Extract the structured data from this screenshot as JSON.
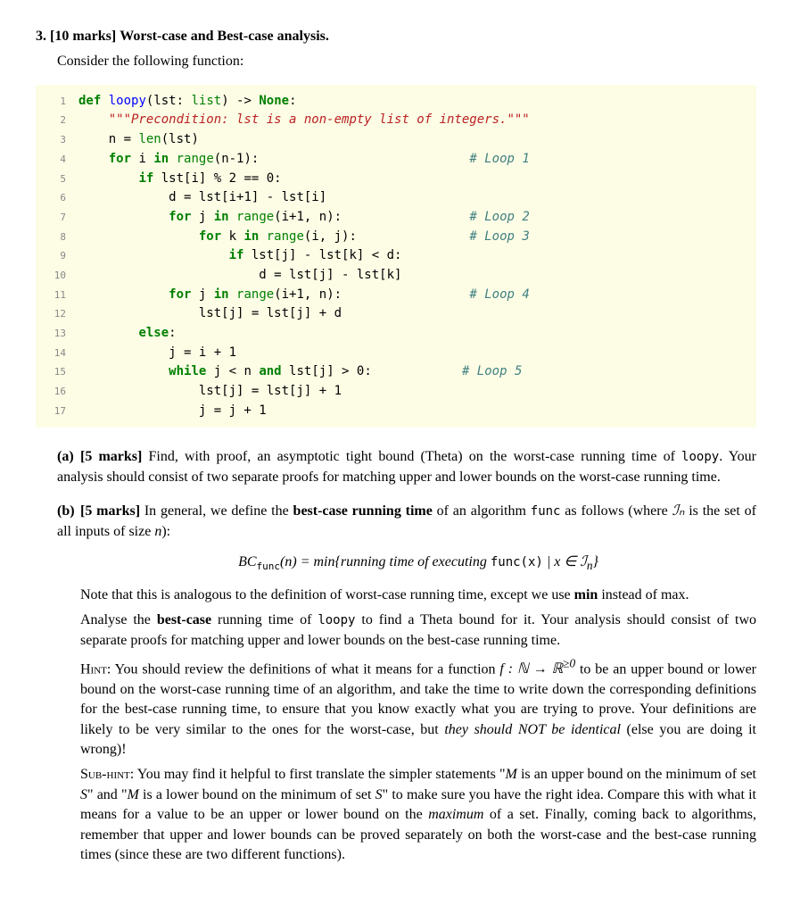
{
  "question": {
    "number": "3.",
    "marks": "[10 marks]",
    "title": "Worst-case and Best-case analysis.",
    "intro": "Consider the following function:"
  },
  "code": {
    "lines": [
      {
        "n": "1",
        "indent": 0,
        "tokens": [
          {
            "t": "kw",
            "v": "def"
          },
          {
            "t": "sp",
            "v": " "
          },
          {
            "t": "fn",
            "v": "loopy"
          },
          {
            "t": "ident",
            "v": "(lst: "
          },
          {
            "t": "bi",
            "v": "list"
          },
          {
            "t": "ident",
            "v": ") -> "
          },
          {
            "t": "kw",
            "v": "None"
          },
          {
            "t": "ident",
            "v": ":"
          }
        ]
      },
      {
        "n": "2",
        "indent": 1,
        "tokens": [
          {
            "t": "str",
            "v": "\"\"\"Precondition: lst is a non-empty list of integers.\"\"\""
          }
        ]
      },
      {
        "n": "3",
        "indent": 1,
        "tokens": [
          {
            "t": "ident",
            "v": "n = "
          },
          {
            "t": "bi",
            "v": "len"
          },
          {
            "t": "ident",
            "v": "(lst)"
          }
        ]
      },
      {
        "n": "4",
        "indent": 1,
        "tokens": [
          {
            "t": "kw",
            "v": "for"
          },
          {
            "t": "ident",
            "v": " i "
          },
          {
            "t": "kw",
            "v": "in"
          },
          {
            "t": "ident",
            "v": " "
          },
          {
            "t": "bi",
            "v": "range"
          },
          {
            "t": "ident",
            "v": "(n-1):"
          }
        ],
        "comment": "# Loop 1",
        "pad": 28
      },
      {
        "n": "5",
        "indent": 2,
        "tokens": [
          {
            "t": "kw",
            "v": "if"
          },
          {
            "t": "ident",
            "v": " lst[i] % 2 == 0:"
          }
        ]
      },
      {
        "n": "6",
        "indent": 3,
        "tokens": [
          {
            "t": "ident",
            "v": "d = lst[i+1] - lst[i]"
          }
        ]
      },
      {
        "n": "7",
        "indent": 3,
        "tokens": [
          {
            "t": "kw",
            "v": "for"
          },
          {
            "t": "ident",
            "v": " j "
          },
          {
            "t": "kw",
            "v": "in"
          },
          {
            "t": "ident",
            "v": " "
          },
          {
            "t": "bi",
            "v": "range"
          },
          {
            "t": "ident",
            "v": "(i+1, n):"
          }
        ],
        "comment": "# Loop 2",
        "pad": 17
      },
      {
        "n": "8",
        "indent": 4,
        "tokens": [
          {
            "t": "kw",
            "v": "for"
          },
          {
            "t": "ident",
            "v": " k "
          },
          {
            "t": "kw",
            "v": "in"
          },
          {
            "t": "ident",
            "v": " "
          },
          {
            "t": "bi",
            "v": "range"
          },
          {
            "t": "ident",
            "v": "(i, j):"
          }
        ],
        "comment": "# Loop 3",
        "pad": 15
      },
      {
        "n": "9",
        "indent": 5,
        "tokens": [
          {
            "t": "kw",
            "v": "if"
          },
          {
            "t": "ident",
            "v": " lst[j] - lst[k] < d:"
          }
        ]
      },
      {
        "n": "10",
        "indent": 6,
        "tokens": [
          {
            "t": "ident",
            "v": "d = lst[j] - lst[k]"
          }
        ]
      },
      {
        "n": "11",
        "indent": 3,
        "tokens": [
          {
            "t": "kw",
            "v": "for"
          },
          {
            "t": "ident",
            "v": " j "
          },
          {
            "t": "kw",
            "v": "in"
          },
          {
            "t": "ident",
            "v": " "
          },
          {
            "t": "bi",
            "v": "range"
          },
          {
            "t": "ident",
            "v": "(i+1, n):"
          }
        ],
        "comment": "# Loop 4",
        "pad": 17
      },
      {
        "n": "12",
        "indent": 4,
        "tokens": [
          {
            "t": "ident",
            "v": "lst[j] = lst[j] + d"
          }
        ]
      },
      {
        "n": "13",
        "indent": 2,
        "tokens": [
          {
            "t": "kw",
            "v": "else"
          },
          {
            "t": "ident",
            "v": ":"
          }
        ]
      },
      {
        "n": "14",
        "indent": 3,
        "tokens": [
          {
            "t": "ident",
            "v": "j = i + 1"
          }
        ]
      },
      {
        "n": "15",
        "indent": 3,
        "tokens": [
          {
            "t": "kw",
            "v": "while"
          },
          {
            "t": "ident",
            "v": " j < n "
          },
          {
            "t": "kw",
            "v": "and"
          },
          {
            "t": "ident",
            "v": " lst[j] > 0:"
          }
        ],
        "comment": "# Loop 5",
        "pad": 12
      },
      {
        "n": "16",
        "indent": 4,
        "tokens": [
          {
            "t": "ident",
            "v": "lst[j] = lst[j] + 1"
          }
        ]
      },
      {
        "n": "17",
        "indent": 4,
        "tokens": [
          {
            "t": "ident",
            "v": "j = j + 1"
          }
        ]
      }
    ]
  },
  "part_a": {
    "label": "(a)",
    "marks": "[5 marks]",
    "text_before_code": " Find, with proof, an asymptotic tight bound (Theta) on the worst-case running time of ",
    "code_word": "loopy",
    "text_after_code": ". Your analysis should consist of two separate proofs for matching upper and lower bounds on the worst-case running time."
  },
  "part_b": {
    "label": "(b)",
    "marks": "[5 marks]",
    "intro_before_bold": " In general, we define the ",
    "bold1": "best-case running time",
    "intro_after_bold": " of an algorithm ",
    "code1": "func",
    "intro_tail": " as follows (where ",
    "in_var": "ℐₙ",
    "intro_tail2": " is the set of all inputs of size ",
    "nvar": "n",
    "intro_tail3": "):",
    "formula": "BC_func(n) = min{running time of executing func(x) | x ∈ ℐₙ}",
    "note1": "Note that this is analogous to the definition of worst-case running time, except we use ",
    "bold_min": "min",
    "note1_tail": " instead of max.",
    "para2_a": "Analyse the ",
    "bold_bc": "best-case",
    "para2_b": " running time of ",
    "code_loopy": "loopy",
    "para2_c": " to find a Theta bound for it. Your analysis should consist of two separate proofs for matching upper and lower bounds on the best-case running time.",
    "hint_label": "Hint:",
    "hint_a": " You should review the definitions of what it means for a function ",
    "hint_f": "f : ℕ → ℝ≥0",
    "hint_b": " to be an upper bound or lower bound on the worst-case running time of an algorithm, and take the time to write down the corresponding definitions for the best-case running time, to ensure that you know exactly what you are trying to prove. Your definitions are likely to be very similar to the ones for the worst-case, but ",
    "hint_italic": "they should NOT be identical",
    "hint_c": " (else you are doing it wrong)!",
    "subhint_label": "Sub-hint:",
    "subhint_a": " You may find it helpful to first translate the simpler statements \"",
    "m1": "M",
    "subhint_b": " is an upper bound on the minimum of set ",
    "s1": "S",
    "subhint_c": "\" and \"",
    "m2": "M",
    "subhint_d": " is a lower bound on the minimum of set ",
    "s2": "S",
    "subhint_e": "\" to make sure you have the right idea. Compare this with what it means for a value to be an upper or lower bound on the ",
    "max_italic": "maximum",
    "subhint_f": " of a set. Finally, coming back to algorithms, remember that upper and lower bounds can be proved separately on both the worst-case and the best-case running times (since these are two different functions)."
  }
}
